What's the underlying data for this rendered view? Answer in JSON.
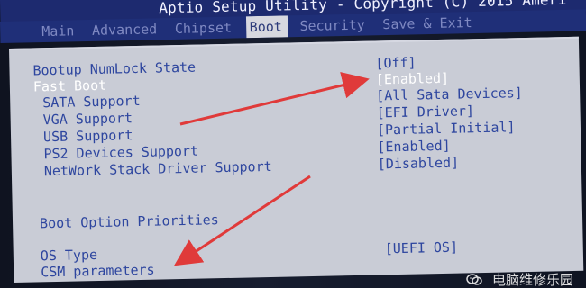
{
  "window": {
    "title": "Aptio Setup Utility - Copyright (C) 2015 Ameri"
  },
  "tabs": [
    {
      "label": "Main"
    },
    {
      "label": "Advanced"
    },
    {
      "label": "Chipset"
    },
    {
      "label": "Boot"
    },
    {
      "label": "Security"
    },
    {
      "label": "Save & Exit"
    }
  ],
  "main": {
    "settings": [
      {
        "label": "Bootup NumLock State",
        "value": "[Off]"
      },
      {
        "label": "Fast Boot",
        "value": "[Enabled]"
      },
      {
        "label": "SATA Support",
        "value": "[All Sata Devices]"
      },
      {
        "label": "VGA Support",
        "value": "[EFI Driver]"
      },
      {
        "label": "USB Support",
        "value": "[Partial Initial]"
      },
      {
        "label": "PS2 Devices Support",
        "value": "[Enabled]"
      },
      {
        "label": "NetWork Stack Driver Support",
        "value": "[Disabled]"
      }
    ],
    "boot_option_priorities": "Boot Option Priorities",
    "os_type": {
      "label": "OS Type",
      "value": "[UEFI OS]"
    },
    "csm_parameters": {
      "label": "CSM parameters"
    }
  },
  "watermark": {
    "text": "电脑维修乐园"
  },
  "colors": {
    "title_bar": "#1d2a6f",
    "tab_bar": "#1f2f78",
    "active_tab_background": "#d7d8df",
    "panel": "#c9ccd6",
    "label_text": "#2e469f",
    "selected_text": "#ffffff",
    "arrow": "#e03a3a"
  },
  "icons": {
    "watermark_icon": "wechat-icon"
  }
}
